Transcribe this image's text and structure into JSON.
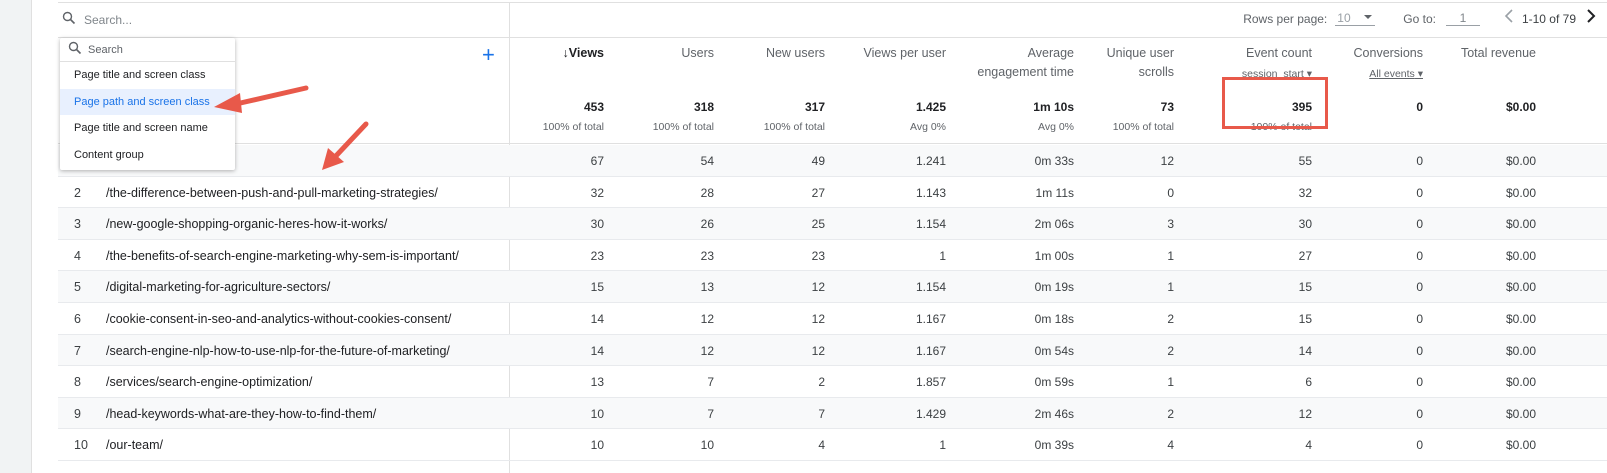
{
  "search": {
    "placeholder": "Search..."
  },
  "pager": {
    "rows_label": "Rows per page:",
    "rows_value": "10",
    "goto_label": "Go to:",
    "goto_value": "1",
    "range": "1-10 of 79"
  },
  "dropdown": {
    "search_placeholder": "Search",
    "items": [
      "Page title and screen class",
      "Page path and screen class",
      "Page title and screen name",
      "Content group"
    ],
    "active_index": 1
  },
  "columns": {
    "views": "↓Views",
    "users": "Users",
    "new_users": "New users",
    "views_per_user": "Views per user",
    "avg_engagement_line1": "Average",
    "avg_engagement_line2": "engagement time",
    "unique_scrolls_line1": "Unique user",
    "unique_scrolls_line2": "scrolls",
    "event_count": "Event count",
    "event_count_sub": "session_start",
    "conversions": "Conversions",
    "conversions_sub": "All events",
    "total_revenue": "Total revenue"
  },
  "totals": {
    "views": "453",
    "views_sub": "100% of total",
    "users": "318",
    "users_sub": "100% of total",
    "new_users": "317",
    "new_users_sub": "100% of total",
    "views_per_user": "1.425",
    "views_per_user_sub": "Avg 0%",
    "avg_engagement": "1m 10s",
    "avg_engagement_sub": "Avg 0%",
    "unique_scrolls": "73",
    "unique_scrolls_sub": "100% of total",
    "event_count": "395",
    "event_count_sub": "100% of total",
    "conversions": "0",
    "total_revenue": "$0.00"
  },
  "rows": [
    {
      "idx": "",
      "path": "",
      "views": "67",
      "users": "54",
      "new_users": "49",
      "vpu": "1.241",
      "eng": "0m 33s",
      "scrolls": "12",
      "events": "55",
      "conv": "0",
      "rev": "$0.00"
    },
    {
      "idx": "2",
      "path": "/the-difference-between-push-and-pull-marketing-strategies/",
      "views": "32",
      "users": "28",
      "new_users": "27",
      "vpu": "1.143",
      "eng": "1m 11s",
      "scrolls": "0",
      "events": "32",
      "conv": "0",
      "rev": "$0.00"
    },
    {
      "idx": "3",
      "path": "/new-google-shopping-organic-heres-how-it-works/",
      "views": "30",
      "users": "26",
      "new_users": "25",
      "vpu": "1.154",
      "eng": "2m 06s",
      "scrolls": "3",
      "events": "30",
      "conv": "0",
      "rev": "$0.00"
    },
    {
      "idx": "4",
      "path": "/the-benefits-of-search-engine-marketing-why-sem-is-important/",
      "views": "23",
      "users": "23",
      "new_users": "23",
      "vpu": "1",
      "eng": "1m 00s",
      "scrolls": "1",
      "events": "27",
      "conv": "0",
      "rev": "$0.00"
    },
    {
      "idx": "5",
      "path": "/digital-marketing-for-agriculture-sectors/",
      "views": "15",
      "users": "13",
      "new_users": "12",
      "vpu": "1.154",
      "eng": "0m 19s",
      "scrolls": "1",
      "events": "15",
      "conv": "0",
      "rev": "$0.00"
    },
    {
      "idx": "6",
      "path": "/cookie-consent-in-seo-and-analytics-without-cookies-consent/",
      "views": "14",
      "users": "12",
      "new_users": "12",
      "vpu": "1.167",
      "eng": "0m 18s",
      "scrolls": "2",
      "events": "15",
      "conv": "0",
      "rev": "$0.00"
    },
    {
      "idx": "7",
      "path": "/search-engine-nlp-how-to-use-nlp-for-the-future-of-marketing/",
      "views": "14",
      "users": "12",
      "new_users": "12",
      "vpu": "1.167",
      "eng": "0m 54s",
      "scrolls": "2",
      "events": "14",
      "conv": "0",
      "rev": "$0.00"
    },
    {
      "idx": "8",
      "path": "/services/search-engine-optimization/",
      "views": "13",
      "users": "7",
      "new_users": "2",
      "vpu": "1.857",
      "eng": "0m 59s",
      "scrolls": "1",
      "events": "6",
      "conv": "0",
      "rev": "$0.00"
    },
    {
      "idx": "9",
      "path": "/head-keywords-what-are-they-how-to-find-them/",
      "views": "10",
      "users": "7",
      "new_users": "7",
      "vpu": "1.429",
      "eng": "2m 46s",
      "scrolls": "2",
      "events": "12",
      "conv": "0",
      "rev": "$0.00"
    },
    {
      "idx": "10",
      "path": "/our-team/",
      "views": "10",
      "users": "10",
      "new_users": "4",
      "vpu": "1",
      "eng": "0m 39s",
      "scrolls": "4",
      "events": "4",
      "conv": "0",
      "rev": "$0.00"
    }
  ],
  "colors": {
    "accent": "#1a73e8",
    "annotation": "#e8594a"
  }
}
